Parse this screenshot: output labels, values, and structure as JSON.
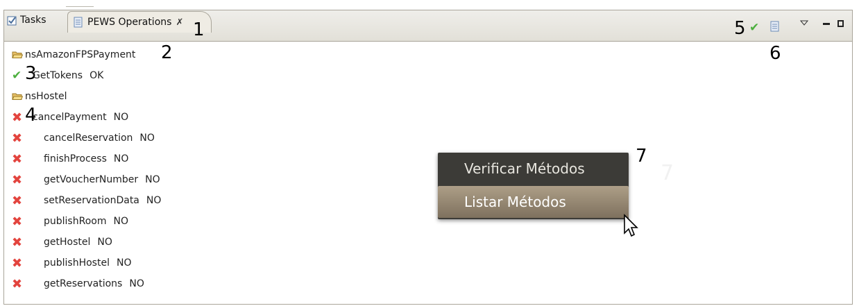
{
  "tabs": [
    {
      "label": "Tasks"
    },
    {
      "label": "PEWS Operations",
      "close": "✗"
    }
  ],
  "annotations": {
    "a1": "1",
    "a2": "2",
    "a3": "3",
    "a4": "4",
    "a5": "5",
    "a6": "6",
    "a7": "7",
    "a7_faint": "7"
  },
  "tree": {
    "groups": [
      {
        "name": "nsAmazonFPSPayment",
        "items": [
          {
            "name": "GetTokens",
            "status": "OK",
            "ok": true
          }
        ]
      },
      {
        "name": "nsHostel",
        "items": [
          {
            "name": "cancelPayment",
            "status": "NO",
            "ok": false
          },
          {
            "name": "cancelReservation",
            "status": "NO",
            "ok": false
          },
          {
            "name": "finishProcess",
            "status": "NO",
            "ok": false
          },
          {
            "name": "getVoucherNumber",
            "status": "NO",
            "ok": false
          },
          {
            "name": "setReservationData",
            "status": "NO",
            "ok": false
          },
          {
            "name": "publishRoom",
            "status": "NO",
            "ok": false
          },
          {
            "name": "getHostel",
            "status": "NO",
            "ok": false
          },
          {
            "name": "publishHostel",
            "status": "NO",
            "ok": false
          },
          {
            "name": "getReservations",
            "status": "NO",
            "ok": false
          }
        ]
      }
    ]
  },
  "context_menu": {
    "items": [
      "Verificar Métodos",
      "Listar Métodos"
    ],
    "selected": 1
  },
  "colors": {
    "ok": "#4caf3e",
    "error": "#e3443e",
    "menu_bg": "#3c3b37",
    "menu_highlight": "#9a8b74"
  }
}
